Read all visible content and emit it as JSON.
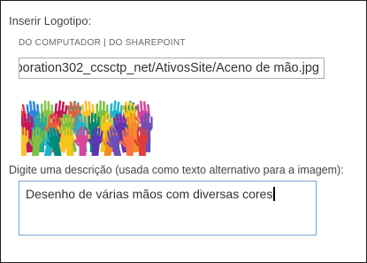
{
  "logo": {
    "label": "Inserir Logotipo:",
    "source_from_computer": "DO COMPUTADOR",
    "source_separator": "|",
    "source_from_sharepoint": "DO SHAREPOINT",
    "path_value": "poration302_ccsctp_net/AtivosSite/Aceno de mão.jpg",
    "image_icon": "raised-hands-image"
  },
  "description": {
    "label": "Digite uma descrição (usada como texto alternativo para a imagem):",
    "value": "Desenho de várias mãos com diversas cores"
  },
  "colors": {
    "frame_border": "#1f1f1f",
    "focus_border": "#7aa6d3",
    "input_border": "#ababab"
  }
}
